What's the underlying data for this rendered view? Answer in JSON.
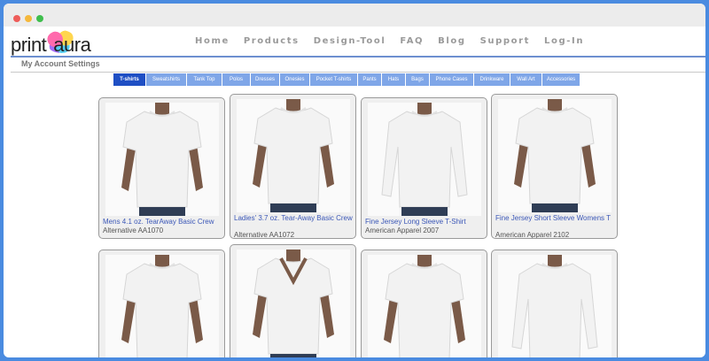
{
  "brand": {
    "logo_text_a": "print",
    "logo_text_b": "aura"
  },
  "nav": [
    {
      "label": "Home"
    },
    {
      "label": "Products"
    },
    {
      "label": "Design-Tool"
    },
    {
      "label": "FAQ"
    },
    {
      "label": "Blog"
    },
    {
      "label": "Support"
    },
    {
      "label": "Log-In"
    }
  ],
  "account": {
    "label": "My Account Settings"
  },
  "tabs": [
    {
      "label": "T-shirts",
      "active": true
    },
    {
      "label": "Sweatshirts"
    },
    {
      "label": "Tank Top"
    },
    {
      "label": "Polos"
    },
    {
      "label": "Dresses"
    },
    {
      "label": "Onesies"
    },
    {
      "label": "Pocket T-shirts"
    },
    {
      "label": "Pants"
    },
    {
      "label": "Hats"
    },
    {
      "label": "Bags"
    },
    {
      "label": "Phone Cases"
    },
    {
      "label": "Drinkware"
    },
    {
      "label": "Wall Art"
    },
    {
      "label": "Accessories"
    }
  ],
  "products": [
    {
      "title": "Mens 4.1 oz. TearAway Basic Crew",
      "sku": "Alternative AA1070",
      "style": "crew-short"
    },
    {
      "title": "Ladies' 3.7 oz. Tear-Away Basic Crew",
      "sku": "Alternative AA1072",
      "style": "crew-short"
    },
    {
      "title": "Fine Jersey Long Sleeve T-Shirt",
      "sku": "American Apparel 2007",
      "style": "long"
    },
    {
      "title": "Fine Jersey Short Sleeve Womens T",
      "sku": "American Apparel 2102",
      "style": "crew-short"
    },
    {
      "title": "",
      "sku": "",
      "style": "crew-short"
    },
    {
      "title": "",
      "sku": "",
      "style": "vneck"
    },
    {
      "title": "",
      "sku": "",
      "style": "crew-short"
    },
    {
      "title": "",
      "sku": "",
      "style": "long"
    }
  ],
  "colors": {
    "accent": "#1f4fc4",
    "tab": "#7fa6e8",
    "link": "#3b57b7",
    "frame": "#4a8be0"
  }
}
